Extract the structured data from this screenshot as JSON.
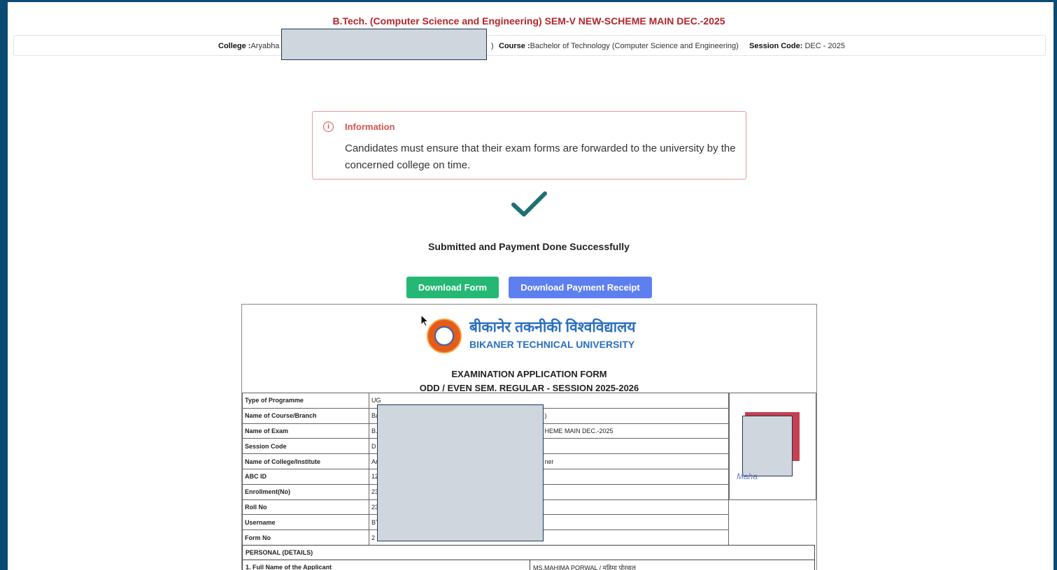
{
  "header": {
    "exam_title": "B.Tech. (Computer Science and Engineering) SEM-V NEW-SCHEME MAIN DEC.-2025",
    "college_label": "College :",
    "college_value": "Aryabha",
    "college_tail": ")",
    "course_label": "Course :",
    "course_value": "Bachelor of Technology (Computer Science and Engineering)",
    "session_label": "Session Code:",
    "session_value": "DEC - 2025"
  },
  "alert": {
    "icon": "info-circle-icon",
    "title": "Information",
    "message": "Candidates must ensure that their exam forms are forwarded to the university by the concerned college on time."
  },
  "success": {
    "icon": "checkmark-icon",
    "message": "Submitted and Payment Done Successfully"
  },
  "buttons": {
    "download_form": "Download Form",
    "download_receipt": "Download Payment Receipt"
  },
  "form": {
    "university_hindi": "बीकानेर तकनीकी विश्वविद्यालय",
    "university_english": "BIKANER TECHNICAL UNIVERSITY",
    "title_line1": "EXAMINATION APPLICATION FORM",
    "title_line2": "ODD / EVEN SEM. REGULAR - SESSION 2025-2026",
    "rows": [
      {
        "label": "Type of Programme",
        "value": "UG",
        "tail": ""
      },
      {
        "label": "Name of Course/Branch",
        "value": "Ba",
        "tail": ")"
      },
      {
        "label": "Name of Exam",
        "value": "B.",
        "tail": "HEME MAIN DEC.-2025"
      },
      {
        "label": "Session Code",
        "value": "D",
        "tail": ""
      },
      {
        "label": "Name of College/Institute",
        "value": "Ar",
        "tail": "ner"
      },
      {
        "label": "ABC ID",
        "value": "12",
        "tail": ""
      },
      {
        "label": "Enrollment(No)",
        "value": "23",
        "tail": ""
      },
      {
        "label": "Roll No",
        "value": "23",
        "tail": ""
      },
      {
        "label": "Username",
        "value": "BT",
        "tail": ""
      },
      {
        "label": "Form No",
        "value": "2",
        "tail": ""
      }
    ],
    "personal_header": "PERSONAL (DETAILS)",
    "full_name_label": "1. Full Name of the Applicant",
    "full_name_value": "MS.MAHIMA PORWAL / महिमा पोरवाल",
    "signature": "Maha"
  },
  "colors": {
    "accent_red": "#b3262c",
    "success_green": "#25b874",
    "primary_blue": "#5d7ff0",
    "university_blue": "#2a6fbf",
    "frame_blue": "#0b4a73"
  }
}
